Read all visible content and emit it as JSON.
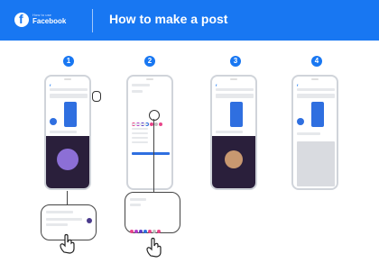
{
  "header": {
    "small_text": "How to use",
    "brand": "Facebook",
    "title": "How to make a post",
    "logo_letter": "f",
    "bg_color": "#1877f2"
  },
  "steps": [
    "1",
    "2",
    "3",
    "4"
  ]
}
